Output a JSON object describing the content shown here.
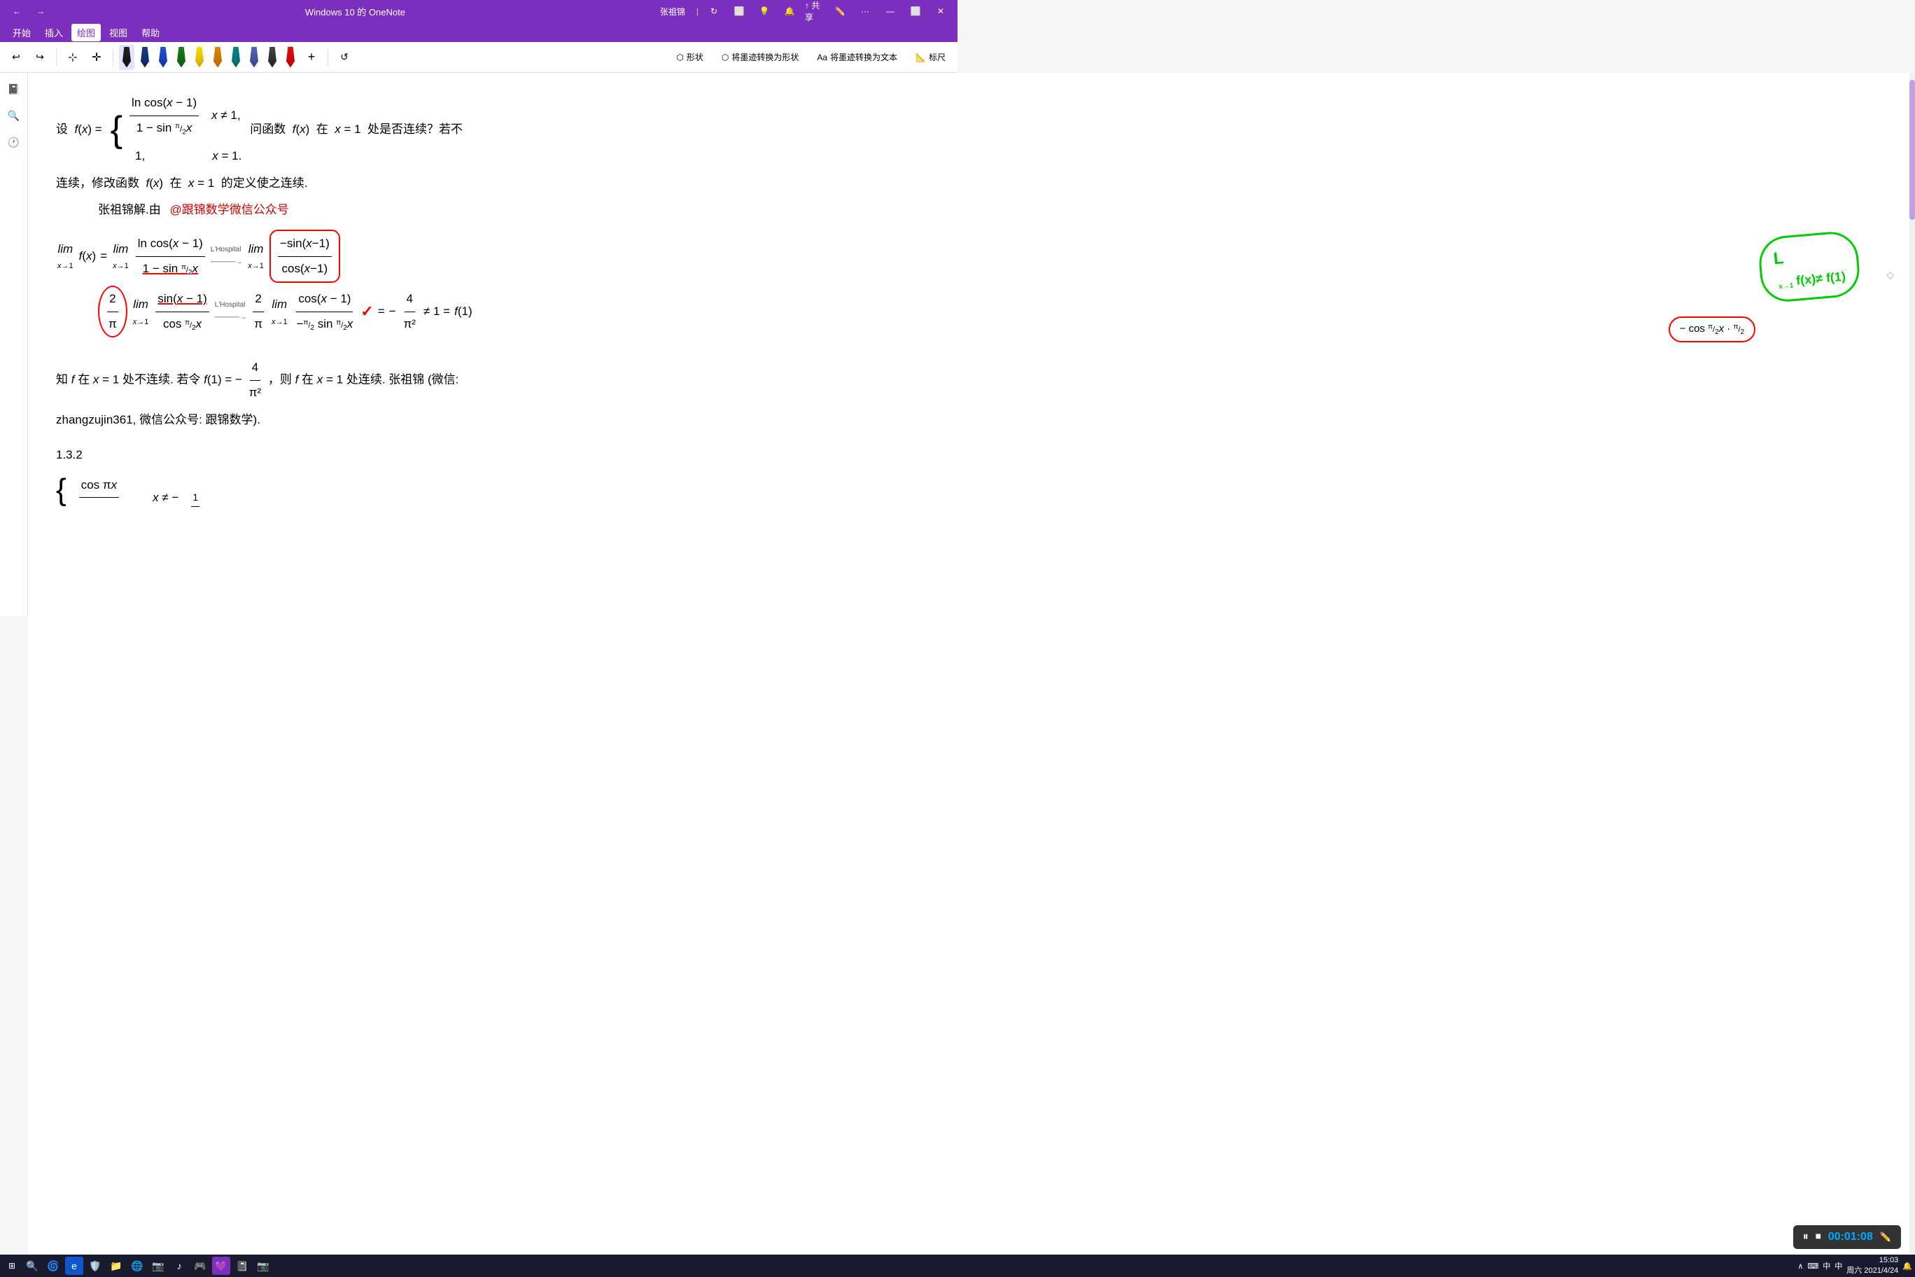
{
  "window": {
    "title": "Windows 10 的 OneNote",
    "user": "张祖锦"
  },
  "menu": {
    "items": [
      "开始",
      "插入",
      "绘图",
      "视图",
      "帮助"
    ],
    "active": "绘图"
  },
  "toolbar": {
    "undo": "↩",
    "redo": "↪",
    "shapes_label": "形状",
    "convert_ink_label": "将墨迹转换为形状",
    "convert_text_label": "将墨迹转换为文本",
    "ruler_label": "标尺"
  },
  "content": {
    "problem": "设  f(x) =",
    "case1_expr": "ln cos(x − 1)",
    "case1_denom": "1 − sin(π/2)x",
    "case1_cond": "x ≠ 1,",
    "case2_expr": "1,",
    "case2_cond": "x = 1.",
    "question": "问函数  f(x)  在  x = 1  处是否连续？若不",
    "cont_text": "连续，修改函数  f(x)  在  x = 1  的定义使之连续.",
    "author": "张祖锦解.由",
    "wechat": "@跟锦数学微信公众号",
    "limit_line1": "lim f(x) = lim",
    "lhospital1": "L'Hospital",
    "lhospital2": "L'Hospital",
    "result": "= − 4/π² ≠ 1 = f(1)",
    "conclusion": "知 f 在 x = 1 处不连续. 若令 f(1) = −4/π²，则 f 在 x = 1 处连续. 张祖锦 (微信:",
    "conclusion2": "zhangzujin361, 微信公众号: 跟锦数学).",
    "section": "1.3.2",
    "cos_fraction_num": "cos πx",
    "cos_fraction_hint1": "x ≠ −",
    "cos_fraction_hint2": "1",
    "green_annotation": "L\n  f(x)≠ f(1)\nx→1",
    "lhospital_arrow": "→"
  },
  "taskbar": {
    "start": "⊞",
    "search": "🔍",
    "items": [
      "🌀",
      "e",
      "🛡️",
      "📁",
      "🌐",
      "📷",
      "♪",
      "🎮",
      "💜",
      "📓",
      "📷"
    ],
    "time": "15:03",
    "date": "2021/4/24",
    "weekday": "周六"
  },
  "media": {
    "pause_icon": "⏸",
    "stop_icon": "⏹",
    "timer": "00:01:08",
    "pen_icon": "✏️"
  }
}
